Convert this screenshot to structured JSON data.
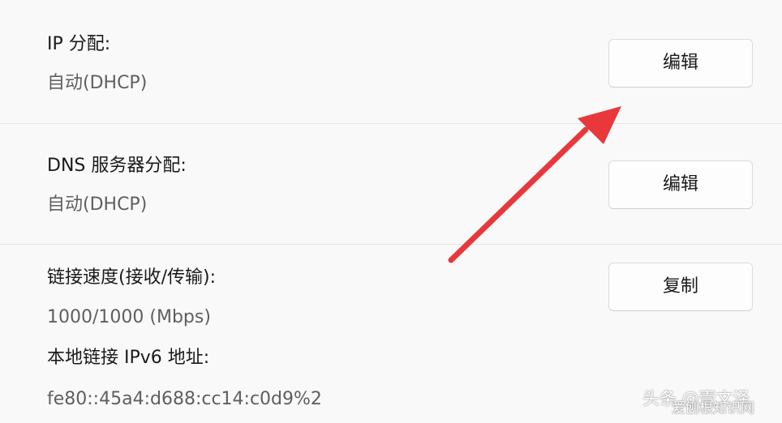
{
  "ip_assignment": {
    "label": "IP 分配:",
    "value": "自动(DHCP)",
    "button_label": "编辑"
  },
  "dns_assignment": {
    "label": "DNS 服务器分配:",
    "value": "自动(DHCP)",
    "button_label": "编辑"
  },
  "link_speed": {
    "label": "链接速度(接收/传输):",
    "value": "1000/1000 (Mbps)",
    "button_label": "复制"
  },
  "ipv6_link_local": {
    "label": "本地链接 IPv6 地址:",
    "value": "fe80::45a4:d688:cc14:c0d9%2"
  },
  "watermark": {
    "text": "头条 @壹文泽",
    "sub_text": "爱刨根知识网"
  },
  "annotation": {
    "arrow_color": "#e8383b",
    "arrow_icon": "red-arrow-icon"
  }
}
